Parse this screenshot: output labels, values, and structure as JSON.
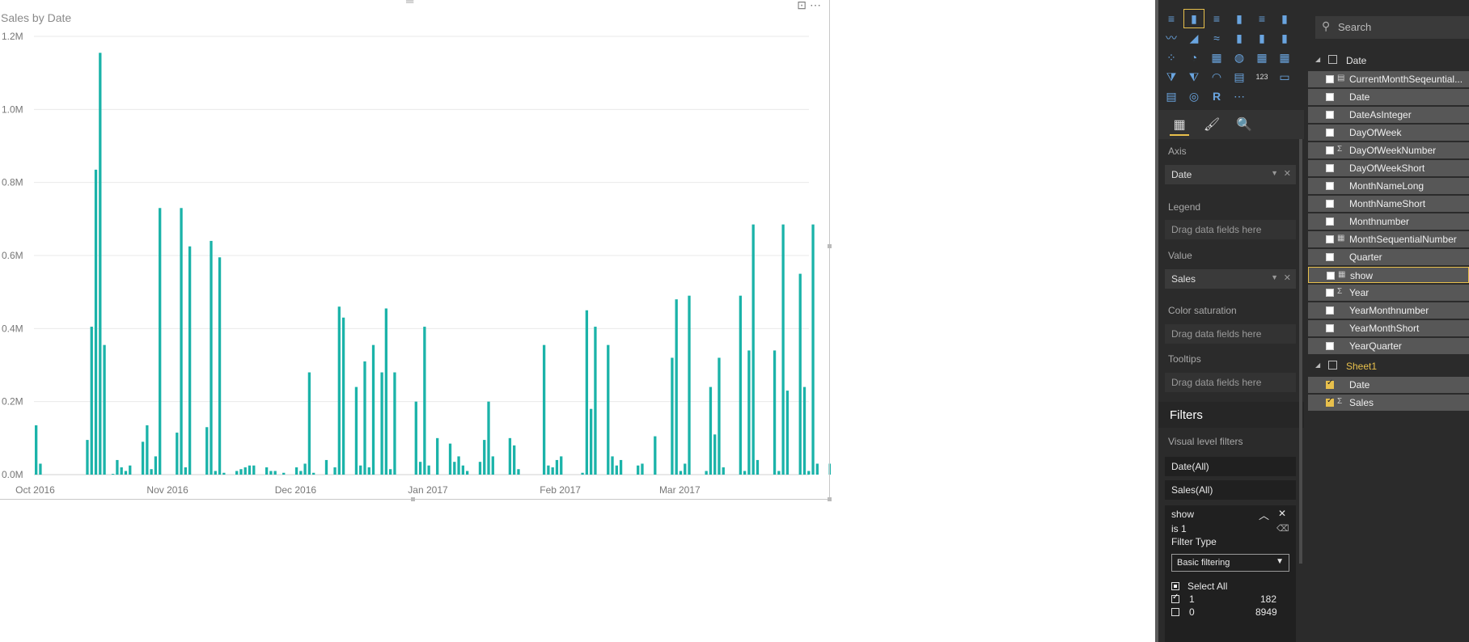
{
  "chart": {
    "title": "Sales by Date",
    "more_icon": "⋯",
    "focus_icon": "⊡",
    "drag_glyph": "═"
  },
  "chart_data": {
    "type": "bar",
    "title": "Sales by Date",
    "xlabel": "",
    "ylabel": "",
    "ylim": [
      0,
      1200000
    ],
    "y_ticks": [
      "0.0M",
      "0.2M",
      "0.4M",
      "0.6M",
      "0.8M",
      "1.0M",
      "1.2M"
    ],
    "x_ticks": [
      "Oct 2016",
      "Nov 2016",
      "Dec 2016",
      "Jan 2017",
      "Feb 2017",
      "Mar 2017"
    ],
    "x_start": "2016-10-01",
    "color": "#1bb3a9",
    "grid": true,
    "values": [
      135000,
      30000,
      0,
      0,
      0,
      0,
      0,
      0,
      0,
      0,
      0,
      0,
      95000,
      405000,
      835000,
      1155000,
      355000,
      0,
      2000,
      40000,
      20000,
      10000,
      25000,
      0,
      0,
      90000,
      135000,
      15000,
      50000,
      730000,
      0,
      0,
      0,
      115000,
      730000,
      20000,
      625000,
      0,
      0,
      0,
      130000,
      640000,
      10000,
      595000,
      5000,
      0,
      0,
      10000,
      15000,
      20000,
      25000,
      25000,
      0,
      0,
      20000,
      10000,
      10000,
      0,
      5000,
      0,
      0,
      20000,
      10000,
      30000,
      280000,
      5000,
      0,
      0,
      40000,
      0,
      20000,
      460000,
      430000,
      0,
      0,
      240000,
      25000,
      310000,
      20000,
      355000,
      0,
      280000,
      455000,
      15000,
      280000,
      0,
      0,
      0,
      0,
      200000,
      35000,
      405000,
      25000,
      0,
      100000,
      0,
      0,
      85000,
      35000,
      50000,
      25000,
      10000,
      0,
      0,
      35000,
      95000,
      200000,
      50000,
      0,
      0,
      0,
      100000,
      80000,
      15000,
      0,
      0,
      0,
      0,
      0,
      355000,
      25000,
      20000,
      40000,
      50000,
      0,
      0,
      0,
      0,
      5000,
      450000,
      180000,
      405000,
      0,
      0,
      355000,
      50000,
      25000,
      40000,
      0,
      0,
      0,
      25000,
      30000,
      0,
      0,
      105000,
      0,
      0,
      0,
      320000,
      480000,
      10000,
      30000,
      490000,
      0,
      0,
      0,
      10000,
      240000,
      110000,
      320000,
      20000,
      0,
      0,
      0,
      490000,
      10000,
      340000,
      685000,
      40000,
      0,
      0,
      0,
      340000,
      10000,
      685000,
      230000,
      0,
      0,
      550000,
      240000,
      10000,
      685000,
      30000,
      0,
      0,
      30000,
      25000
    ]
  },
  "visualizations": {
    "icon_rows": [
      [
        "≡",
        "▮",
        "≡",
        "▮",
        "≡",
        "▮"
      ],
      [
        "〰",
        "◢",
        "≈",
        "▮",
        "▮",
        "▮"
      ],
      [
        "⁘",
        "◔",
        "▦",
        "◍",
        "▦",
        "▦"
      ],
      [
        "⧩",
        "⧨",
        "◠",
        "▤",
        "123",
        "▭"
      ],
      [
        "▤",
        "◎",
        "R",
        "⋯"
      ]
    ],
    "tabs": [
      "▦",
      "🖌",
      "🔍"
    ],
    "wells": {
      "axis_label": "Axis",
      "axis_value": "Date",
      "legend_label": "Legend",
      "legend_placeholder": "Drag data fields here",
      "value_label": "Value",
      "value_value": "Sales",
      "color_label": "Color saturation",
      "color_placeholder": "Drag data fields here",
      "tooltips_label": "Tooltips",
      "tooltips_placeholder": "Drag data fields here"
    },
    "filters": {
      "title": "Filters",
      "level": "Visual level filters",
      "date_filter": "Date(All)",
      "sales_filter": "Sales(All)",
      "show_card": {
        "title": "show",
        "condition": "is 1",
        "filter_type_label": "Filter Type",
        "filter_type_value": "Basic filtering",
        "select_all": "Select All",
        "items": [
          {
            "label": "1",
            "count": "182",
            "checked": true
          },
          {
            "label": "0",
            "count": "8949",
            "checked": false
          }
        ]
      }
    }
  },
  "fields": {
    "search_placeholder": "Search",
    "tables": [
      {
        "name": "Date",
        "fields": [
          {
            "name": "CurrentMonthSeqeuntial...",
            "icon": "calc",
            "checked": false
          },
          {
            "name": "Date",
            "icon": "",
            "checked": false
          },
          {
            "name": "DateAsInteger",
            "icon": "",
            "checked": false
          },
          {
            "name": "DayOfWeek",
            "icon": "",
            "checked": false
          },
          {
            "name": "DayOfWeekNumber",
            "icon": "sigma",
            "checked": false
          },
          {
            "name": "DayOfWeekShort",
            "icon": "",
            "checked": false
          },
          {
            "name": "MonthNameLong",
            "icon": "",
            "checked": false
          },
          {
            "name": "MonthNameShort",
            "icon": "",
            "checked": false
          },
          {
            "name": "Monthnumber",
            "icon": "",
            "checked": false
          },
          {
            "name": "MonthSequentialNumber",
            "icon": "table",
            "checked": false
          },
          {
            "name": "Quarter",
            "icon": "",
            "checked": false
          },
          {
            "name": "show",
            "icon": "table",
            "checked": false,
            "highlight": true
          },
          {
            "name": "Year",
            "icon": "sigma",
            "checked": false
          },
          {
            "name": "YearMonthnumber",
            "icon": "",
            "checked": false
          },
          {
            "name": "YearMonthShort",
            "icon": "",
            "checked": false
          },
          {
            "name": "YearQuarter",
            "icon": "",
            "checked": false
          }
        ]
      },
      {
        "name": "Sheet1",
        "fields": [
          {
            "name": "Date",
            "icon": "",
            "checked": true
          },
          {
            "name": "Sales",
            "icon": "sigma",
            "checked": true
          }
        ]
      }
    ]
  }
}
